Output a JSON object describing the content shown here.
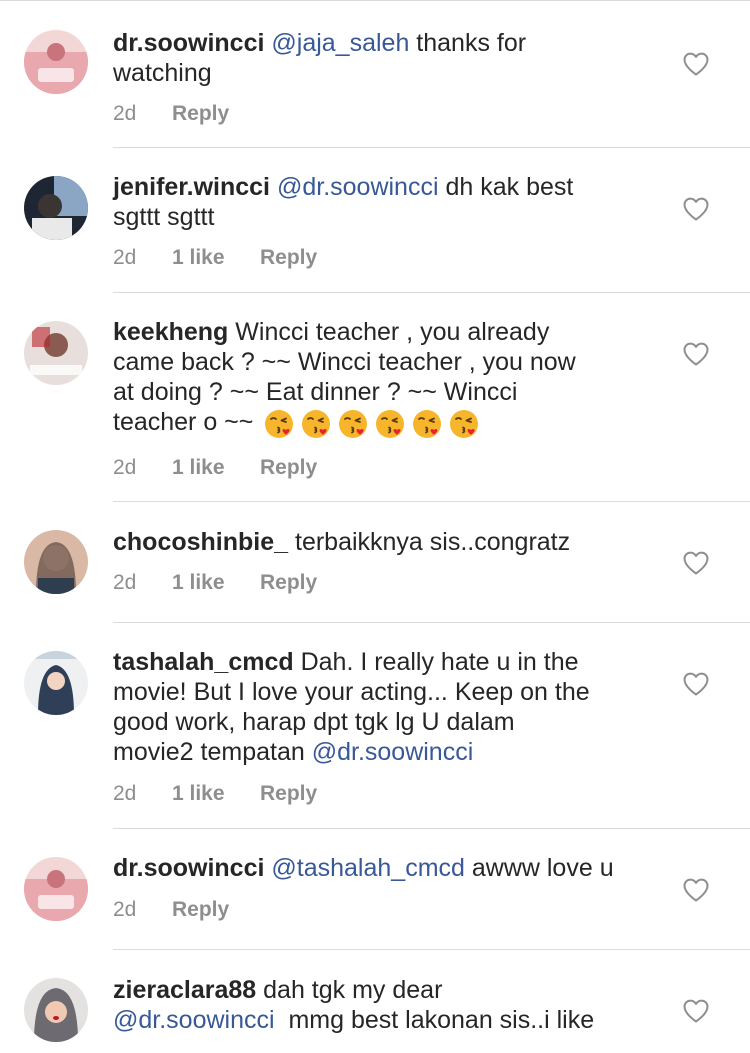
{
  "comments": [
    {
      "username": "dr.soowincci",
      "mention": "@jaja_saleh",
      "text": " thanks for",
      "text2": "watching",
      "time": "2d",
      "reply": "Reply"
    },
    {
      "username": "jenifer.wincci",
      "mention": "@dr.soowincci",
      "text": " dh kak best",
      "text2": "sgttt sgttt",
      "time": "2d",
      "likes": "1 like",
      "reply": "Reply"
    },
    {
      "username": "keekheng",
      "text": " Wincci teacher , you already",
      "text2": "came back ? ~~ Wincci teacher , you now",
      "text3": "at doing ? ~~ Eat dinner ? ~~ Wincci",
      "text4": "teacher o ~~",
      "time": "2d",
      "likes": "1 like",
      "reply": "Reply"
    },
    {
      "username": "chocoshinbie_",
      "text": " terbaikknya sis..congratz",
      "time": "2d",
      "likes": "1 like",
      "reply": "Reply"
    },
    {
      "username": "tashalah_cmcd",
      "text": " Dah. I really hate u in the",
      "text2": "movie! But I love your acting... Keep on the",
      "text3": "good work, harap dpt tgk lg U dalam",
      "text4": "movie2 tempatan ",
      "mention_end": "@dr.soowincci",
      "time": "2d",
      "likes": "1 like",
      "reply": "Reply"
    },
    {
      "username": "dr.soowincci",
      "mention": "@tashalah_cmcd",
      "text": " awww love u",
      "time": "2d",
      "reply": "Reply"
    },
    {
      "username": "zieraclara88",
      "text": " dah tgk my dear",
      "mention_line2": "@dr.soowincci",
      "text2": "  mmg best lakonan sis..i like"
    }
  ],
  "icons": {
    "heart": "heart-outline-icon",
    "emoji": "kissing-face-emoji"
  },
  "colors": {
    "mention": "#385898",
    "meta": "#8e8e8e",
    "text": "#262626",
    "divider": "#dbdbdb"
  }
}
